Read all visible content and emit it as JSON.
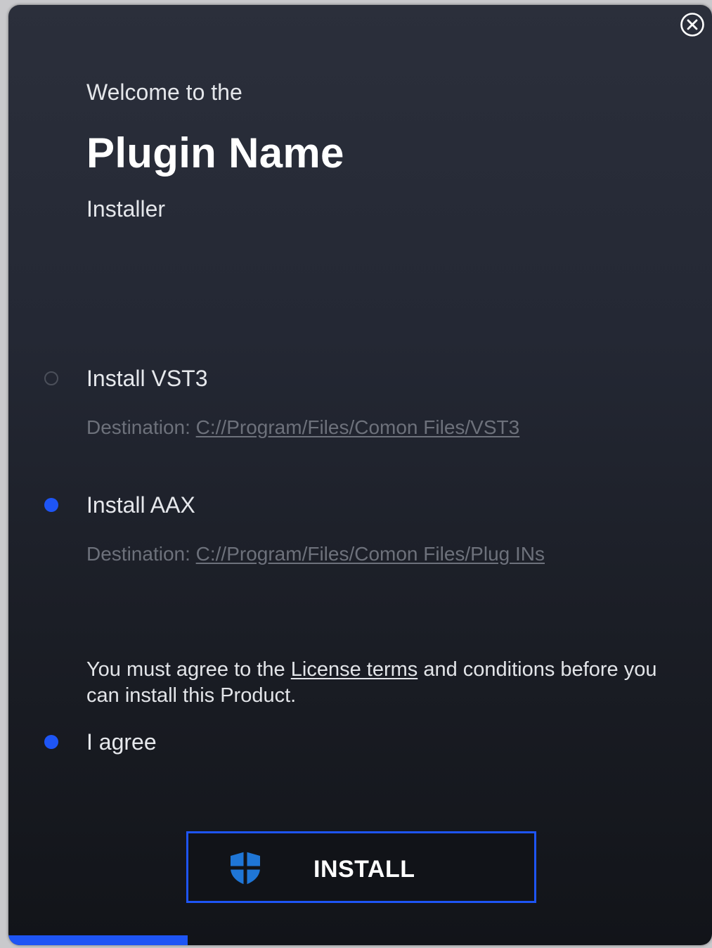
{
  "header": {
    "welcome": "Welcome to the",
    "product_name": "Plugin Name",
    "subtitle": "Installer"
  },
  "options": [
    {
      "label": "Install VST3",
      "selected": false,
      "destination_prefix": "Destination: ",
      "destination_path": "C://Program/Files/Comon Files/VST3"
    },
    {
      "label": "Install AAX",
      "selected": true,
      "destination_prefix": "Destination: ",
      "destination_path": "C://Program/Files/Comon Files/Plug INs"
    }
  ],
  "license": {
    "text_before": "You must agree to the ",
    "link": "License terms",
    "text_after": " and conditions before you can install this Product."
  },
  "agree": {
    "label": "I agree",
    "selected": true
  },
  "install_button": {
    "label": "INSTALL",
    "icon": "shield-icon"
  },
  "progress": {
    "fraction": 0.255
  },
  "colors": {
    "accent": "#1e55f5",
    "background_top": "#2b2f3b",
    "background_bottom": "#121419"
  },
  "icons": {
    "close": "close-icon",
    "shield": "shield-icon"
  }
}
